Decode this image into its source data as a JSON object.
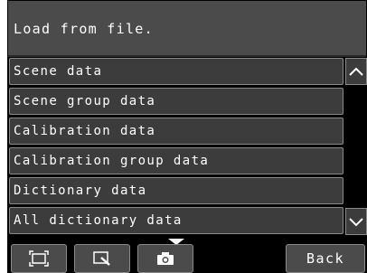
{
  "title": "Load from file.",
  "items": [
    {
      "label": "Scene data"
    },
    {
      "label": "Scene group data"
    },
    {
      "label": "Calibration data"
    },
    {
      "label": "Calibration group data"
    },
    {
      "label": "Dictionary data"
    },
    {
      "label": "All dictionary data"
    }
  ],
  "toolbar": {
    "back_label": "Back",
    "icons": [
      "fit-screen-icon",
      "zoom-select-icon",
      "camera-icon"
    ]
  },
  "colors": {
    "background": "#000000",
    "button": "#3c3c3c",
    "title_bar": "#4b4b4b",
    "border": "#8a8a8a",
    "text": "#ffffff"
  }
}
